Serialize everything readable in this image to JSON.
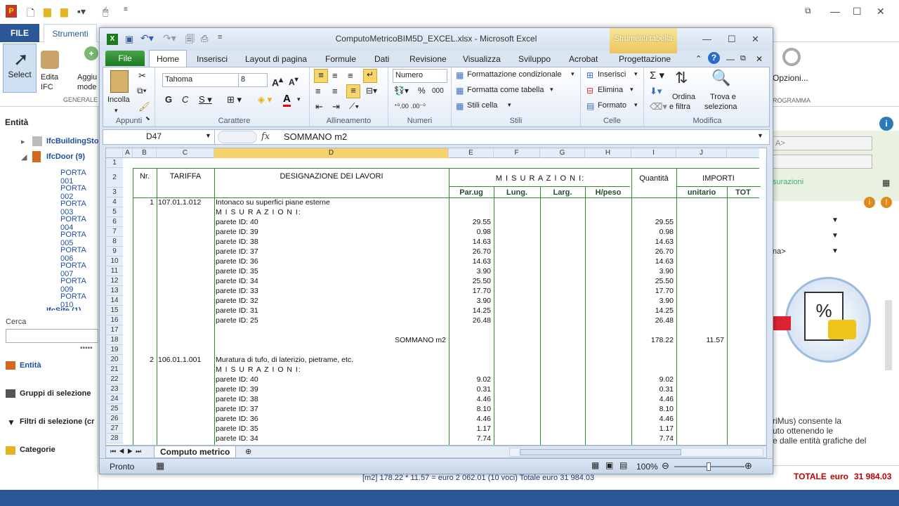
{
  "bg": {
    "file_tab": "FILE",
    "strumenti_tab": "Strumenti",
    "select_label": "Select",
    "edita_label": "Edita",
    "ifc_label": "IFC",
    "aggiungi_label": "Aggiu",
    "mode_label": "mode",
    "generale_label": "GENERALE",
    "opzioni_label": "Opzioni...",
    "programma_label": "ROGRAMMA",
    "entita_title": "Entità",
    "tree": [
      "IfcBuildingSto",
      "IfcDoor (9)"
    ],
    "porte": [
      "PORTA 001",
      "PORTA 002",
      "PORTA 003",
      "PORTA 004",
      "PORTA 005",
      "PORTA 006",
      "PORTA 007",
      "PORTA 009",
      "PORTA 010"
    ],
    "tree_cut": "IfcSite (1)",
    "cerca_label": "Cerca",
    "nav": [
      "Entità",
      "Gruppi di selezione",
      "Filtri di selezione (cr",
      "Categorie"
    ],
    "right_a": "A>",
    "right_misurazioni": "surazioni",
    "right_na": "na>",
    "right_text": [
      "riMus) consente la",
      "uto ottenendo le",
      "e dalle entità grafiche del"
    ],
    "summary": "[m2] 178.22 * 11.57 = euro 2 062.01   (10 voci)  Totale   euro   31 984.03",
    "totale_label": "TOTALE",
    "totale_euro": "euro",
    "totale_value": "31 984.03"
  },
  "xl": {
    "title": "ComputoMetricoBIM5D_EXCEL.xlsx  -  Microsoft Excel",
    "contextual_tab": "Strumenti tabella",
    "tabs": [
      "Inserisci",
      "Layout di pagina",
      "Formule",
      "Dati",
      "Revisione",
      "Visualizza",
      "Sviluppo",
      "Acrobat",
      "Progettazione"
    ],
    "file_tab": "File",
    "home_tab": "Home",
    "incolla": "Incolla",
    "font": "Tahoma",
    "size": "8",
    "number_format": "Numero",
    "cond_format": "Formattazione condizionale",
    "format_table": "Formatta come tabella",
    "cell_styles": "Stili cella",
    "insert": "Inserisci",
    "delete": "Elimina",
    "format": "Formato",
    "sort": [
      "Ordina",
      "e filtra"
    ],
    "find": [
      "Trova e",
      "seleziona"
    ],
    "groups": [
      "Appunti",
      "Carattere",
      "Allineamento",
      "Numeri",
      "Stili",
      "Celle",
      "Modifica"
    ],
    "namebox": "D47",
    "formula": "SOMMANO m2",
    "sheet_tab": "Computo metrico",
    "status": "Pronto",
    "zoom": "100%"
  },
  "grid": {
    "columns": [
      "A",
      "B",
      "C",
      "D",
      "E",
      "F",
      "G",
      "H",
      "I",
      "J"
    ],
    "header": {
      "nr": "Nr.",
      "tariffa": "TARIFFA",
      "designazione": "DESIGNAZIONE DEI LAVORI",
      "misurazioni": "M I S U R A Z I O N I:",
      "quantita": "Quantità",
      "importi": "IMPORTI",
      "parug": "Par.ug",
      "lung": "Lung.",
      "larg": "Larg.",
      "hpeso": "H/peso",
      "unitario": "unitario",
      "totale": "TOT"
    },
    "rows": [
      {
        "r": "4",
        "b": "1",
        "c": "107.01.1.012",
        "d": "Intonaco su superfici piane esterne",
        "e": "",
        "i": "",
        "j": ""
      },
      {
        "r": "5",
        "b": "",
        "c": "",
        "d": "M I S U R A Z I O N I:",
        "e": "",
        "i": "",
        "j": ""
      },
      {
        "r": "6",
        "b": "",
        "c": "",
        "d": "parete ID: 40",
        "e": "29.55",
        "i": "29.55",
        "j": ""
      },
      {
        "r": "7",
        "b": "",
        "c": "",
        "d": "parete ID: 39",
        "e": "0.98",
        "i": "0.98",
        "j": ""
      },
      {
        "r": "8",
        "b": "",
        "c": "",
        "d": "parete ID: 38",
        "e": "14.63",
        "i": "14.63",
        "j": ""
      },
      {
        "r": "9",
        "b": "",
        "c": "",
        "d": "parete ID: 37",
        "e": "26.70",
        "i": "26.70",
        "j": ""
      },
      {
        "r": "10",
        "b": "",
        "c": "",
        "d": "parete ID: 36",
        "e": "14.63",
        "i": "14.63",
        "j": ""
      },
      {
        "r": "11",
        "b": "",
        "c": "",
        "d": "parete ID: 35",
        "e": "3.90",
        "i": "3.90",
        "j": ""
      },
      {
        "r": "12",
        "b": "",
        "c": "",
        "d": "parete ID: 34",
        "e": "25.50",
        "i": "25.50",
        "j": ""
      },
      {
        "r": "13",
        "b": "",
        "c": "",
        "d": "parete ID: 33",
        "e": "17.70",
        "i": "17.70",
        "j": ""
      },
      {
        "r": "14",
        "b": "",
        "c": "",
        "d": "parete ID: 32",
        "e": "3.90",
        "i": "3.90",
        "j": ""
      },
      {
        "r": "15",
        "b": "",
        "c": "",
        "d": "parete ID: 31",
        "e": "14.25",
        "i": "14.25",
        "j": ""
      },
      {
        "r": "16",
        "b": "",
        "c": "",
        "d": "parete ID: 25",
        "e": "26.48",
        "i": "26.48",
        "j": ""
      },
      {
        "r": "17",
        "b": "",
        "c": "",
        "d": "",
        "e": "",
        "i": "",
        "j": ""
      },
      {
        "r": "18",
        "b": "",
        "c": "",
        "d": "SOMMANO m2",
        "e": "",
        "i": "178.22",
        "j": "11.57"
      },
      {
        "r": "19",
        "b": "",
        "c": "",
        "d": "",
        "e": "",
        "i": "",
        "j": ""
      },
      {
        "r": "20",
        "b": "2",
        "c": "106.01.1.001",
        "d": "Muratura di tufo, di laterizio, pietrame, etc.",
        "e": "",
        "i": "",
        "j": ""
      },
      {
        "r": "21",
        "b": "",
        "c": "",
        "d": "M I S U R A Z I O N I:",
        "e": "",
        "i": "",
        "j": ""
      },
      {
        "r": "22",
        "b": "",
        "c": "",
        "d": "parete ID: 40",
        "e": "9.02",
        "i": "9.02",
        "j": ""
      },
      {
        "r": "23",
        "b": "",
        "c": "",
        "d": "parete ID: 39",
        "e": "0.31",
        "i": "0.31",
        "j": ""
      },
      {
        "r": "24",
        "b": "",
        "c": "",
        "d": "parete ID: 38",
        "e": "4.46",
        "i": "4.46",
        "j": ""
      },
      {
        "r": "25",
        "b": "",
        "c": "",
        "d": "parete ID: 37",
        "e": "8.10",
        "i": "8.10",
        "j": ""
      },
      {
        "r": "26",
        "b": "",
        "c": "",
        "d": "parete ID: 36",
        "e": "4.46",
        "i": "4.46",
        "j": ""
      },
      {
        "r": "27",
        "b": "",
        "c": "",
        "d": "parete ID: 35",
        "e": "1.17",
        "i": "1.17",
        "j": ""
      },
      {
        "r": "28",
        "b": "",
        "c": "",
        "d": "parete ID: 34",
        "e": "7.74",
        "i": "7.74",
        "j": ""
      }
    ]
  }
}
